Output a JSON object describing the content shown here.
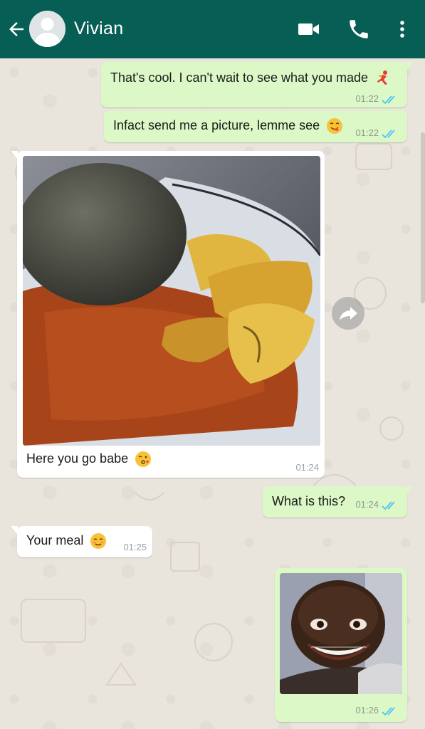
{
  "header": {
    "contact_name": "Vivian",
    "back_icon": "arrow-left-icon",
    "video_icon": "video-call-icon",
    "call_icon": "phone-icon",
    "menu_icon": "more-vert-icon",
    "background": "#075e54"
  },
  "colors": {
    "outgoing_bubble": "#dcf8c6",
    "incoming_bubble": "#ffffff",
    "read_ticks": "#4fc3f7",
    "chat_background": "#e9e4dc"
  },
  "messages": [
    {
      "direction": "out",
      "text": "That's cool. I can't wait to see what you made",
      "emoji": "dancer-emoji",
      "time": "01:22",
      "status": "read"
    },
    {
      "direction": "out",
      "text": "Infact send me a picture, lemme see",
      "emoji": "yum-face-emoji",
      "time": "01:22",
      "status": "read"
    },
    {
      "direction": "in",
      "type": "image",
      "image": "food-photo-fufu-plantain-stew",
      "caption": "Here you go babe",
      "emoji": "kissing-face-emoji",
      "time": "01:24"
    },
    {
      "direction": "out",
      "text": "What is this?",
      "time": "01:24",
      "status": "read"
    },
    {
      "direction": "in",
      "text": "Your meal",
      "emoji": "smiling-face-emoji",
      "time": "01:25"
    },
    {
      "direction": "out",
      "type": "image",
      "image": "funny-face-meme-photo",
      "time": "01:26",
      "status": "read"
    }
  ]
}
